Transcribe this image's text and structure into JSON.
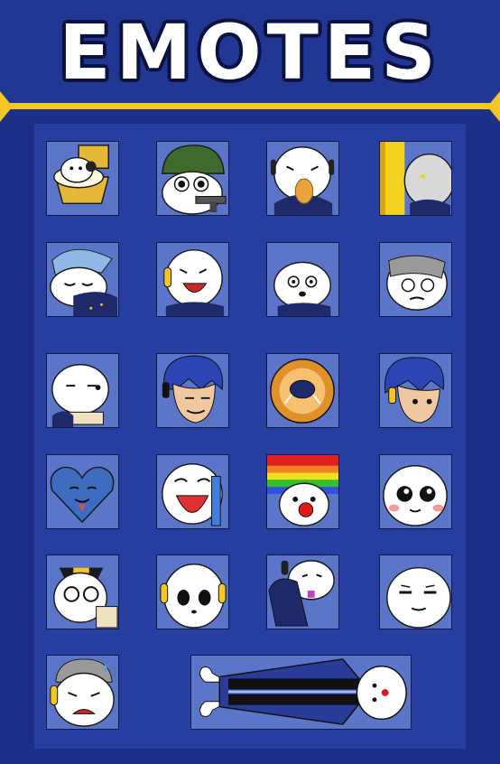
{
  "header": {
    "title": "EMOTES"
  },
  "colors": {
    "background": "#1d2f86",
    "panel": "#283ea0",
    "tile": "#5b75c9",
    "accent_gold": "#f3c624",
    "title_text": "#ffffff",
    "outline": "#0c1240"
  },
  "emotes": [
    {
      "icon": "seal-in-toilet-icon"
    },
    {
      "icon": "seal-soldier-gun-icon"
    },
    {
      "icon": "seal-eating-icon"
    },
    {
      "icon": "seal-peeking-door-icon"
    },
    {
      "icon": "seal-sleeping-icon"
    },
    {
      "icon": "seal-laughing-icon"
    },
    {
      "icon": "seal-shocked-icon"
    },
    {
      "icon": "seal-bandaged-icon"
    },
    {
      "icon": "seal-reading-icon"
    },
    {
      "icon": "blue-hair-smirk-icon"
    },
    {
      "icon": "seal-in-pie-icon"
    },
    {
      "icon": "blue-hair-face-icon"
    },
    {
      "icon": "heart-cat-icon"
    },
    {
      "icon": "seal-crying-icon"
    },
    {
      "icon": "seal-clown-icon"
    },
    {
      "icon": "seal-blushing-icon"
    },
    {
      "icon": "seal-detective-icon"
    },
    {
      "icon": "seal-stare-icon"
    },
    {
      "icon": "seal-mouth-cover-icon"
    },
    {
      "icon": "seal-smug-icon"
    },
    {
      "icon": "seal-sad-icon"
    },
    {
      "icon": "seal-hotdog-bed-icon"
    }
  ]
}
